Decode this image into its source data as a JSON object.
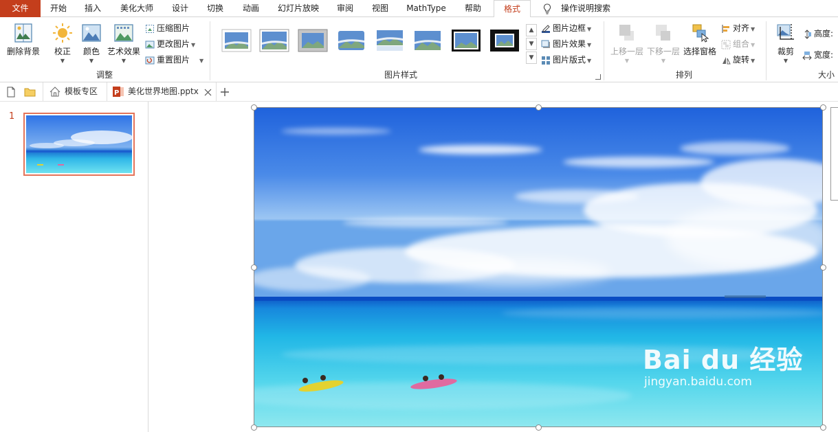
{
  "menubar": {
    "tabs": [
      "文件",
      "开始",
      "插入",
      "美化大师",
      "设计",
      "切换",
      "动画",
      "幻灯片放映",
      "审阅",
      "视图",
      "MathType",
      "帮助",
      "格式"
    ],
    "search_label": "操作说明搜索"
  },
  "ribbon": {
    "adjust": {
      "remove_bg": "删除背景",
      "corrections": "校正",
      "color": "颜色",
      "artistic": "艺术效果",
      "compress": "压缩图片",
      "change": "更改图片",
      "reset": "重置图片",
      "group_label": "调整"
    },
    "styles": {
      "border": "图片边框",
      "effects": "图片效果",
      "layout": "图片版式",
      "group_label": "图片样式"
    },
    "arrange": {
      "bring_forward": "上移一层",
      "send_backward": "下移一层",
      "selection_pane": "选择窗格",
      "align": "对齐",
      "group": "组合",
      "rotate": "旋转",
      "group_label": "排列"
    },
    "size": {
      "crop": "裁剪",
      "height": "高度:",
      "width": "宽度:",
      "group_label": "大小"
    }
  },
  "tabbar": {
    "template_tab": "模板专区",
    "doc_tab": "美化世界地图.pptx"
  },
  "slides": {
    "current_number": "1"
  },
  "watermark": {
    "brand": "Bai du 经验",
    "url": "jingyan.baidu.com"
  },
  "colors": {
    "accent": "#c43e1c",
    "thumb_border": "#e4745a"
  }
}
